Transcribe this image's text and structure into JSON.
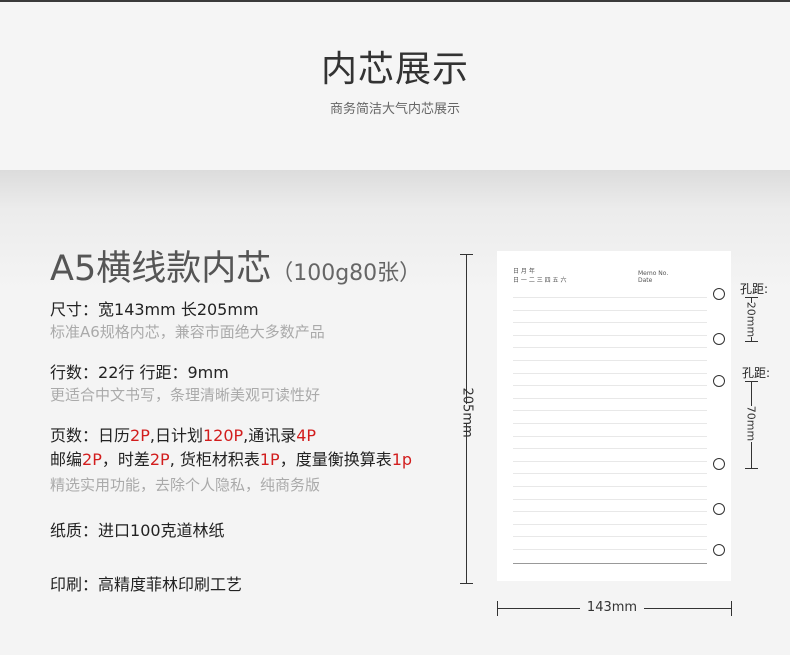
{
  "header": {
    "title": "内芯展示",
    "subtitle": "商务简洁大气内芯展示"
  },
  "product": {
    "title": "A5横线款内芯",
    "title_sub": "（100g80张）"
  },
  "specs": {
    "size": {
      "label": "尺寸：",
      "value": "宽143mm   长205mm",
      "note": "标准A6规格内芯，兼容市面绝大多数产品"
    },
    "lines": {
      "label": "行数：",
      "value": "22行    行距：9mm",
      "note": "更适合中文书写，条理清晰美观可读性好"
    },
    "pages": {
      "label": "页数：",
      "line1": [
        {
          "t": "日历",
          "red": false
        },
        {
          "t": "2P",
          "red": true
        },
        {
          "t": ",日计划",
          "red": false
        },
        {
          "t": "120P",
          "red": true
        },
        {
          "t": ",通讯录",
          "red": false
        },
        {
          "t": "4P",
          "red": true
        }
      ],
      "line2": [
        {
          "t": "邮编",
          "red": false
        },
        {
          "t": "2P",
          "red": true
        },
        {
          "t": "，时差",
          "red": false
        },
        {
          "t": "2P",
          "red": true
        },
        {
          "t": ", 货柜材积表",
          "red": false
        },
        {
          "t": "1P",
          "red": true
        },
        {
          "t": "，度量衡换算表",
          "red": false
        },
        {
          "t": "1p",
          "red": true
        }
      ],
      "note": "精选实用功能，去除个人隐私，纯商务版"
    },
    "paper": {
      "label": "纸质：",
      "value": "进口100克道林纸"
    },
    "print": {
      "label": "印刷：",
      "value": "高精度菲林印刷工艺"
    }
  },
  "diagram": {
    "height_label": "205mm",
    "width_label": "143mm",
    "hole_spacing_label": "孔距:",
    "hole_spacing_small": "20mm",
    "hole_spacing_large": "70mm",
    "sheet_header_memo": "Memo No.",
    "sheet_header_date": "Date",
    "sheet_header_left": "日 月 年",
    "sheet_header_days": "日 一 二 三 四 五 六"
  },
  "colors": {
    "accent_red": "#d21d1d",
    "text_dark": "#222222",
    "text_muted": "#aaaaaa"
  }
}
